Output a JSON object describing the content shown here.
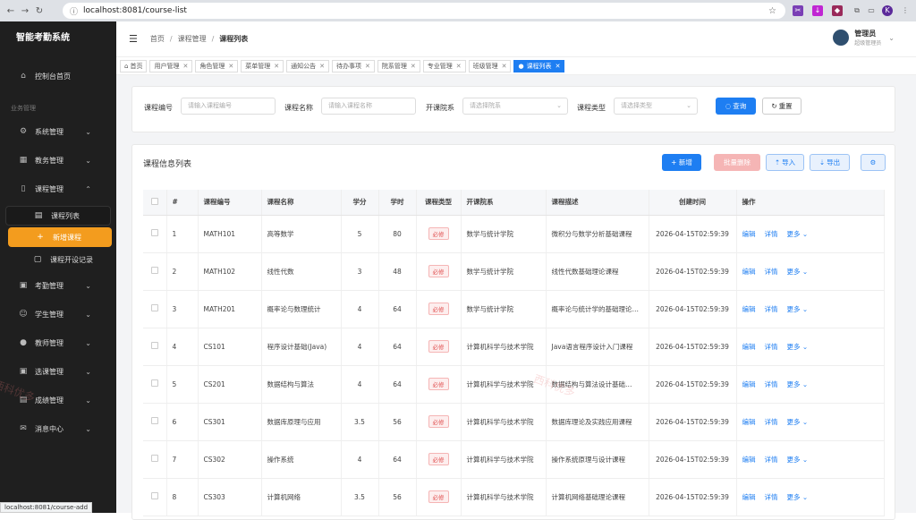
{
  "browser": {
    "url": "localhost:8081/course-list",
    "status_url": "localhost:8081/course-add"
  },
  "sidebar": {
    "logo": "智能考勤系统",
    "dashboard": "控制台首页",
    "section": "业务管理",
    "items": [
      {
        "label": "系统管理",
        "icon": "gear-icon"
      },
      {
        "label": "教务管理",
        "icon": "building-icon"
      },
      {
        "label": "课程管理",
        "icon": "book-icon"
      }
    ],
    "sub": [
      {
        "label": "课程列表"
      },
      {
        "label": "新增课程"
      },
      {
        "label": "课程开设记录"
      }
    ],
    "items2": [
      {
        "label": "考勤管理",
        "icon": "calendar-icon"
      },
      {
        "label": "学生管理",
        "icon": "user-icon"
      },
      {
        "label": "教师管理",
        "icon": "teacher-icon"
      },
      {
        "label": "选课管理",
        "icon": "calendar-icon"
      },
      {
        "label": "成绩管理",
        "icon": "document-icon"
      },
      {
        "label": "消息中心",
        "icon": "mail-icon"
      }
    ]
  },
  "topbar": {
    "breadcrumb": [
      "首页",
      "课程管理",
      "课程列表"
    ],
    "user_name": "管理员",
    "user_role": "超级管理员"
  },
  "tags": [
    {
      "label": "首页",
      "home": true
    },
    {
      "label": "用户管理"
    },
    {
      "label": "角色管理"
    },
    {
      "label": "菜单管理"
    },
    {
      "label": "通知公告"
    },
    {
      "label": "待办事项"
    },
    {
      "label": "院系管理"
    },
    {
      "label": "专业管理"
    },
    {
      "label": "班级管理"
    },
    {
      "label": "课程列表",
      "active": true
    }
  ],
  "search": {
    "code_label": "课程编号",
    "code_placeholder": "请输入课程编号",
    "name_label": "课程名称",
    "name_placeholder": "请输入课程名称",
    "dept_label": "开课院系",
    "dept_placeholder": "请选择院系",
    "type_label": "课程类型",
    "type_placeholder": "请选择类型",
    "query": "查询",
    "reset": "重置"
  },
  "panel": {
    "title": "课程信息列表",
    "add": "+ 新增",
    "batch_delete": "批量删除",
    "import": "导入",
    "export": "导出"
  },
  "table": {
    "headers": [
      "#",
      "课程编号",
      "课程名称",
      "学分",
      "学时",
      "课程类型",
      "开课院系",
      "课程描述",
      "创建时间",
      "操作"
    ],
    "rows": [
      [
        "1",
        "MATH101",
        "高等数学",
        "5",
        "80",
        "必修",
        "数学与统计学院",
        "微积分与数学分析基础课程",
        "2026-04-15T02:59:39"
      ],
      [
        "2",
        "MATH102",
        "线性代数",
        "3",
        "48",
        "必修",
        "数学与统计学院",
        "线性代数基础理论课程",
        "2026-04-15T02:59:39"
      ],
      [
        "3",
        "MATH201",
        "概率论与数理统计",
        "4",
        "64",
        "必修",
        "数学与统计学院",
        "概率论与统计学的基础理论…",
        "2026-04-15T02:59:39"
      ],
      [
        "4",
        "CS101",
        "程序设计基础(Java)",
        "4",
        "64",
        "必修",
        "计算机科学与技术学院",
        "Java语言程序设计入门课程",
        "2026-04-15T02:59:39"
      ],
      [
        "5",
        "CS201",
        "数据结构与算法",
        "4",
        "64",
        "必修",
        "计算机科学与技术学院",
        "数据结构与算法设计基础…",
        "2026-04-15T02:59:39"
      ],
      [
        "6",
        "CS301",
        "数据库原理与应用",
        "3.5",
        "56",
        "必修",
        "计算机科学与技术学院",
        "数据库理论及实践应用课程",
        "2026-04-15T02:59:39"
      ],
      [
        "7",
        "CS302",
        "操作系统",
        "4",
        "64",
        "必修",
        "计算机科学与技术学院",
        "操作系统原理与设计课程",
        "2026-04-15T02:59:39"
      ],
      [
        "8",
        "CS303",
        "计算机网络",
        "3.5",
        "56",
        "必修",
        "计算机科学与技术学院",
        "计算机网络基础理论课程",
        "2026-04-15T02:59:39"
      ]
    ],
    "ops": [
      "编辑",
      "详情",
      "更多"
    ]
  },
  "watermark": "西科优多"
}
